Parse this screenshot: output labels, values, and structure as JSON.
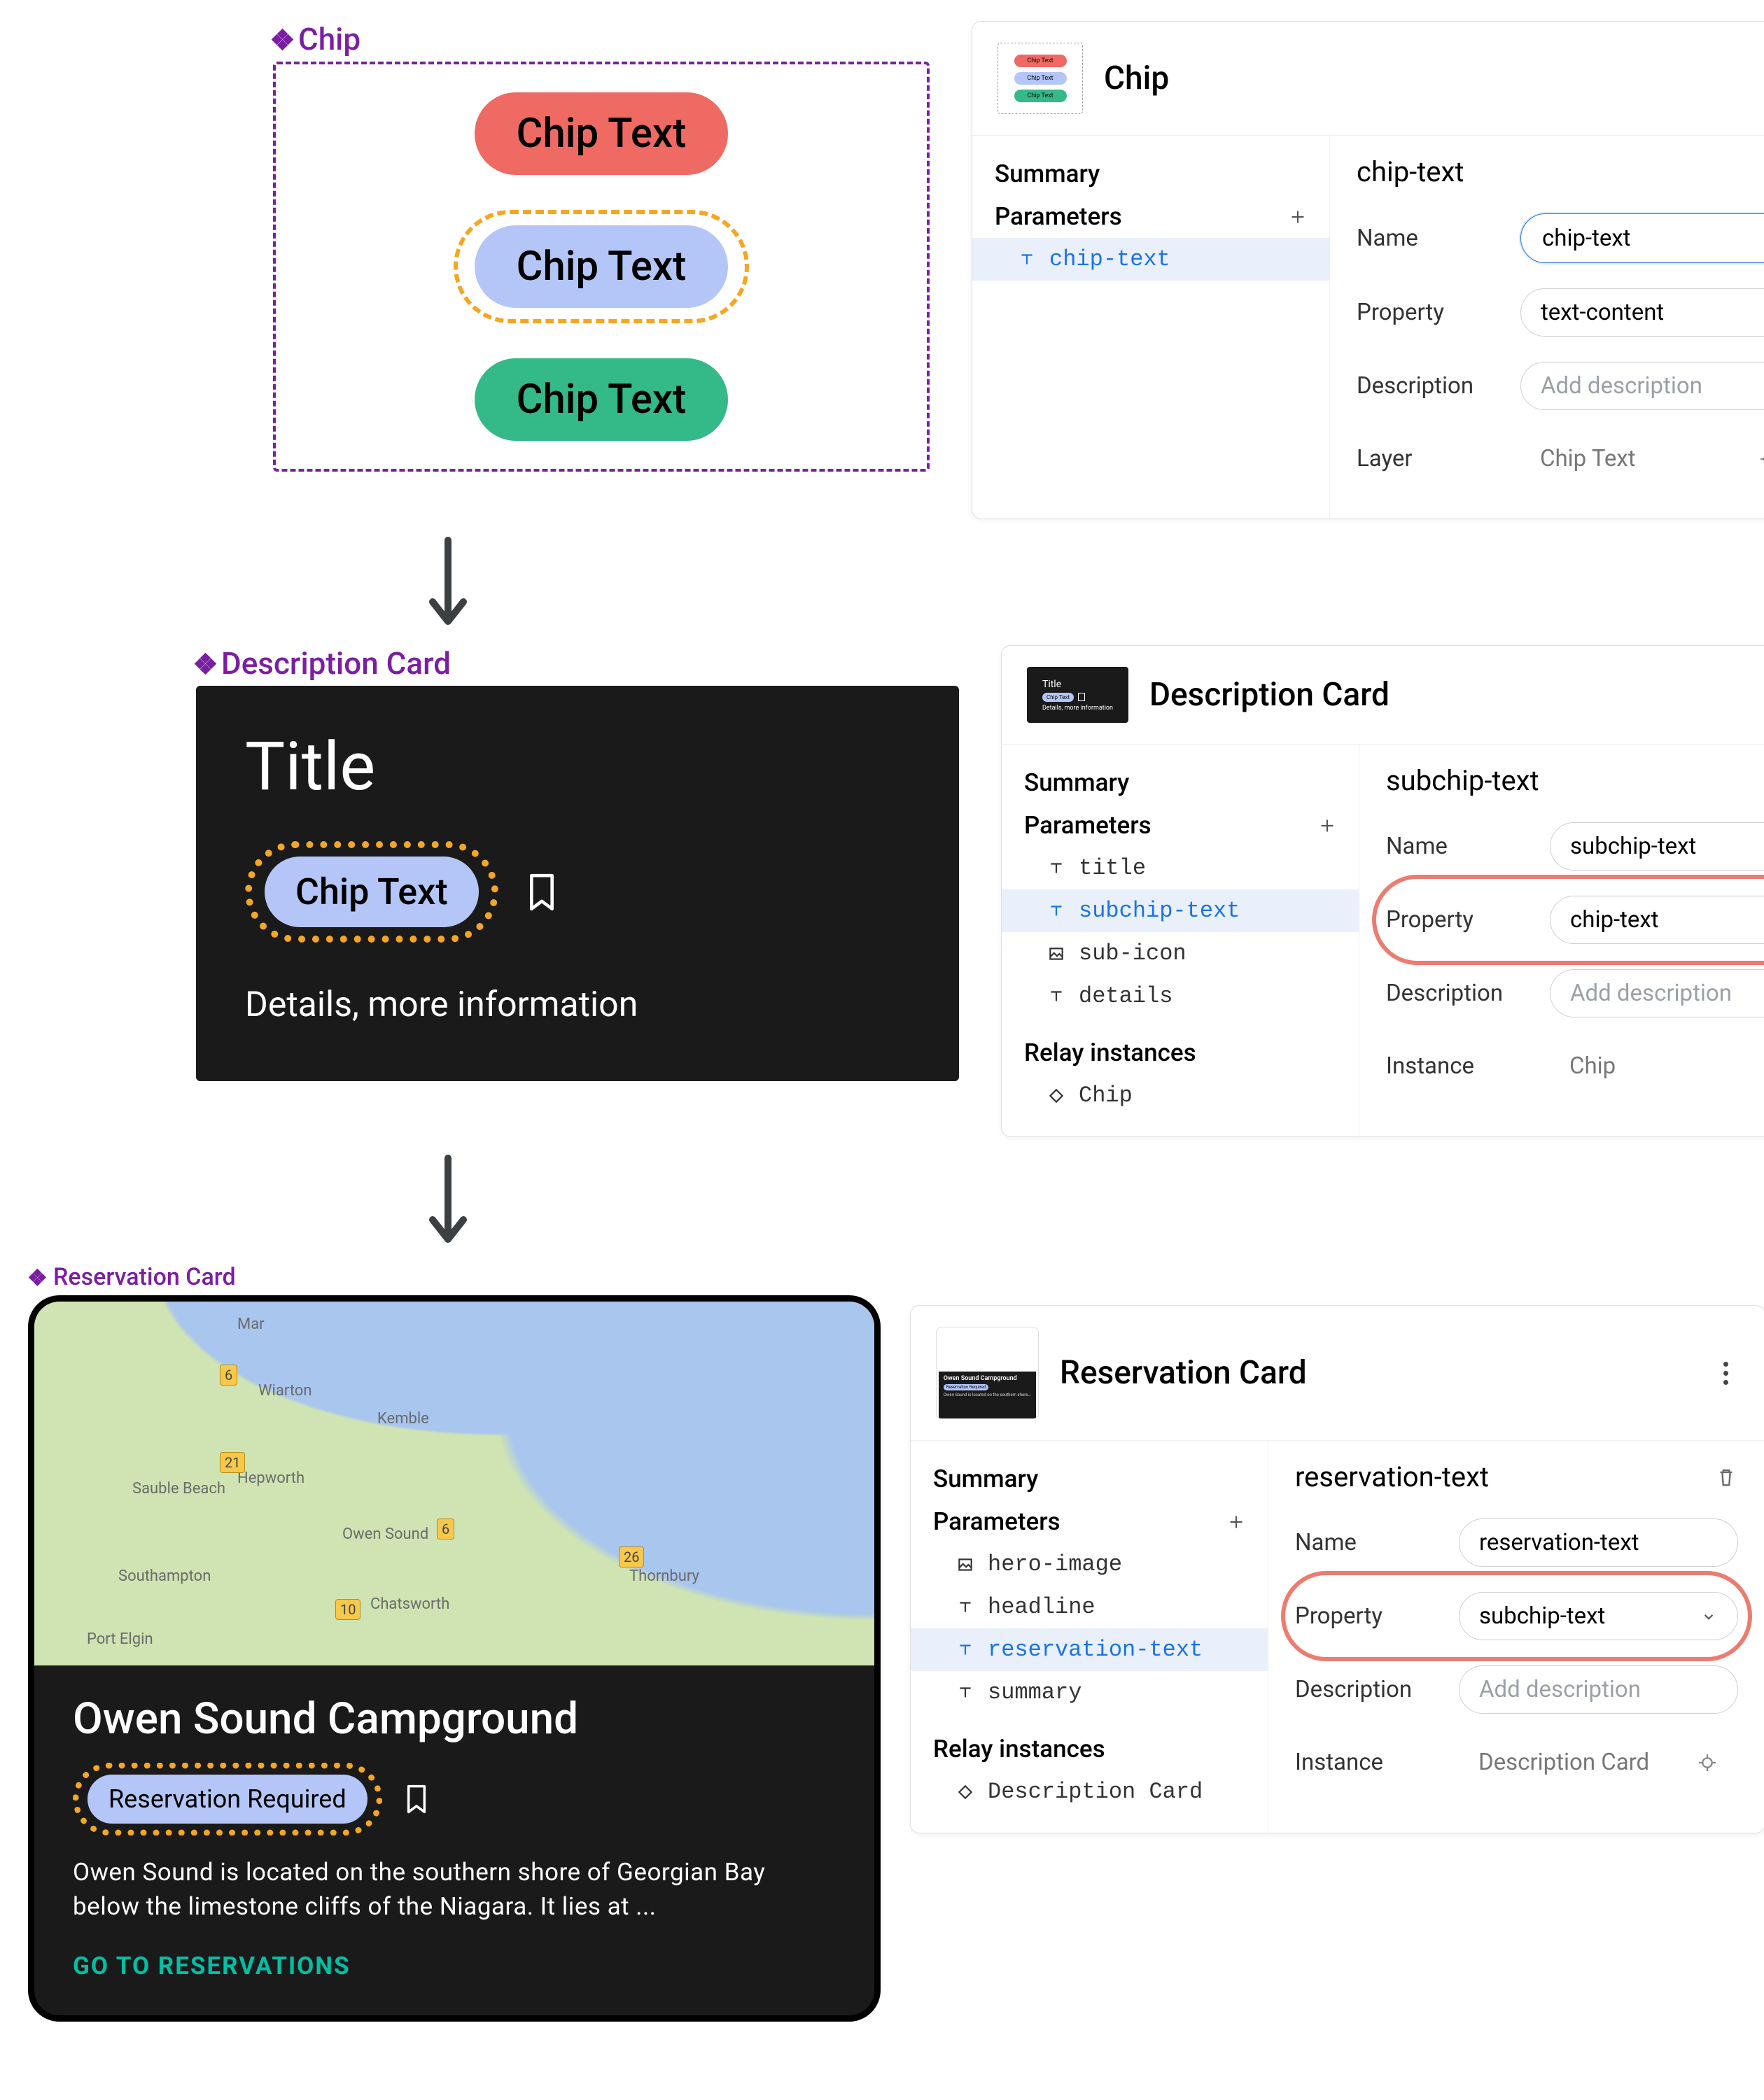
{
  "labels": {
    "chip": "Chip",
    "desc": "Description Card",
    "res": "Reservation Card"
  },
  "chips": {
    "red": "Chip Text",
    "blue": "Chip Text",
    "green": "Chip Text"
  },
  "descCard": {
    "title": "Title",
    "chip": "Chip Text",
    "details": "Details, more information"
  },
  "resCard": {
    "head": "Owen Sound Campground",
    "chip": "Reservation Required",
    "summary": "Owen Sound is located on the southern shore of Georgian Bay below the limestone cliffs of the Niagara. It lies at ...",
    "cta": "GO TO RESERVATIONS",
    "map": {
      "places": [
        "Mar",
        "Wiarton",
        "Kemble",
        "Hepworth",
        "Sauble Beach",
        "Owen Sound",
        "Southampton",
        "Chatsworth",
        "Port Elgin",
        "Thornbury"
      ],
      "roads": [
        "6",
        "21",
        "10",
        "26",
        "6"
      ]
    }
  },
  "panels": {
    "summary": "Summary",
    "parameters": "Parameters",
    "relay": "Relay instances",
    "name": "Name",
    "property": "Property",
    "description": "Description",
    "desc_placeholder": "Add description",
    "layer": "Layer",
    "instance": "Instance"
  },
  "panel1": {
    "title": "Chip",
    "param": "chip-text",
    "prName": "chip-text",
    "nameVal": "chip-text",
    "propVal": "text-content",
    "layerVal": "Chip Text"
  },
  "panel2": {
    "title": "Description Card",
    "params": {
      "p1": "title",
      "p2": "subchip-text",
      "p3": "sub-icon",
      "p4": "details"
    },
    "relayItem": "Chip",
    "prName": "subchip-text",
    "nameVal": "subchip-text",
    "propVal": "chip-text",
    "instanceVal": "Chip"
  },
  "panel3": {
    "title": "Reservation Card",
    "params": {
      "p1": "hero-image",
      "p2": "headline",
      "p3": "reservation-text",
      "p4": "summary"
    },
    "relayItem": "Description Card",
    "prName": "reservation-text",
    "nameVal": "reservation-text",
    "propVal": "subchip-text",
    "instanceVal": "Description Card"
  },
  "thumbChips": {
    "a": "Chip Text",
    "b": "Chip Text",
    "c": "Chip Text"
  }
}
